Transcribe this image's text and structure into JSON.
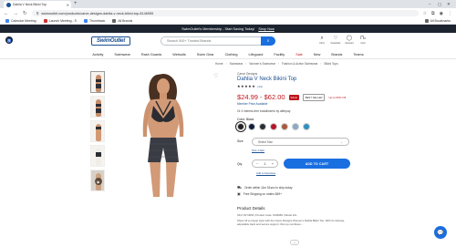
{
  "browser": {
    "tab_title": "Dahlia V Neck Bikini Top",
    "new_tab_symbol": "+",
    "url": "swimoutlet.com/products/carve-designs-dahlia-v-neck-bikini-top-8146955",
    "bookmarks": [
      "Calendar Meeting",
      "Launch Meeting - S",
      "Thumbtack",
      "All Brands"
    ],
    "all_bookmarks_label": "All Bookmarks"
  },
  "promo": {
    "text": "SwimOutlet's Membership - Start Saving Today!",
    "link": "Shop Now"
  },
  "header": {
    "logo": "SwimOutlet",
    "search_placeholder": "Search 500+ Trusted Brands",
    "icons": [
      {
        "label": "Find",
        "glyph": "⌕"
      },
      {
        "label": "Favorites",
        "glyph": "♡"
      },
      {
        "label": "Account",
        "glyph": "◯"
      },
      {
        "label": "Cart",
        "glyph": "⊓"
      }
    ],
    "cart_count": "0"
  },
  "nav": [
    "Activity",
    "Swimwear",
    "Rash Guards",
    "Wetsuits",
    "Swim Gear",
    "Clothing",
    "Lifeguard",
    "Facility",
    "Sale",
    "New",
    "Brands",
    "Teams"
  ],
  "breadcrumb": [
    "Home",
    "Swimwear",
    "Women's Swimwear",
    "Fashion & Active Swimwear",
    "Bikini Tops"
  ],
  "product": {
    "brand": "Carve Designs",
    "title": "Dahlia V Neck Bikini Top",
    "stars": "★★★★★",
    "review_count": "(14)",
    "price": "$24.99 - $62.00",
    "sale_badge": "SALE",
    "best_seller_badge": "BEST SELLER",
    "save_text": "Up to 60% Off",
    "member_text": "Member Price Available",
    "afterpay_text": "Or 4 interest-free installments by afterpay",
    "color_label": "Color:",
    "color_value": "Black",
    "swatches": [
      "#1f1f24",
      "#0f1e3d",
      "#2b2e36",
      "#b8142a",
      "#a85b3c",
      "#8aa9c5",
      "#2f8fbf"
    ],
    "size_label": "Size",
    "size_placeholder": "Select Size",
    "size_chart": "Size Chart",
    "qty_label": "Qty",
    "qty_value": "1",
    "add_to_cart": "ADD TO CART",
    "add_to_registry": "Add to Favorites",
    "shipping_1": "Order within 11m 51sec to ship today",
    "shipping_2": "Free Shipping on orders $49+",
    "details_heading": "Product Details",
    "details_meta": "SKU: 8174654 | Product Code: 0196983 | Model Info",
    "details_desc": "Show off a unique style with the Carve Designs Women's Dahlia Bikini Top. With its intimate, adjustable back and secure support, this top combines..."
  },
  "chat_icon": "chat-bubble-icon"
}
